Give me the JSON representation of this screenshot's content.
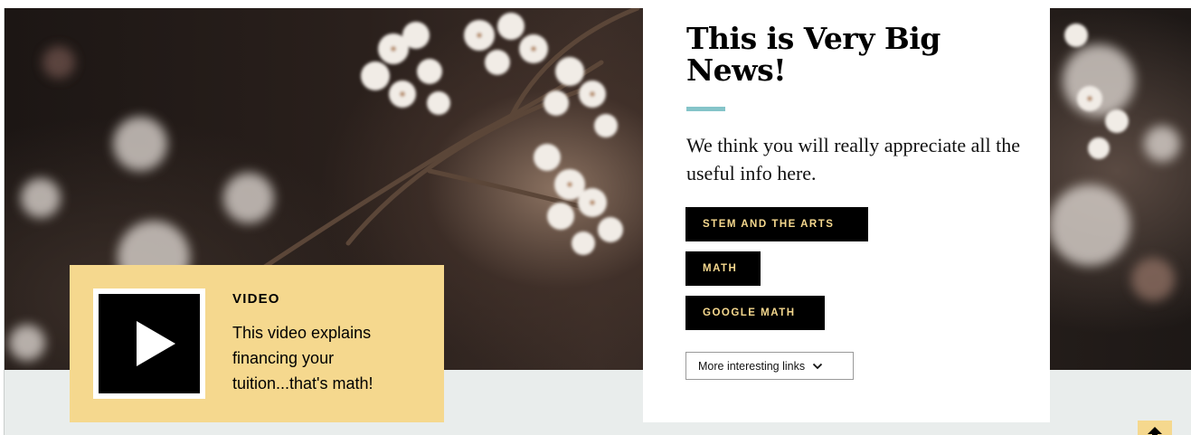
{
  "video": {
    "label": "VIDEO",
    "description": "This video explains financing your tuition...that's math!",
    "play_icon": "play-icon"
  },
  "news": {
    "title": "This is Very Big News!",
    "body": "We think you will really appreciate all the useful info here.",
    "tags": [
      "STEM AND THE ARTS",
      "MATH",
      "GOOGLE MATH"
    ],
    "more_links_label": "More interesting links",
    "more_links_icon": "chevron-down-icon"
  },
  "back_to_top_icon": "arrow-up-icon",
  "colors": {
    "accent_gold": "#f5d88e",
    "accent_teal": "#85c4c9",
    "band_gray": "#e9edec",
    "tag_bg": "#000000"
  }
}
